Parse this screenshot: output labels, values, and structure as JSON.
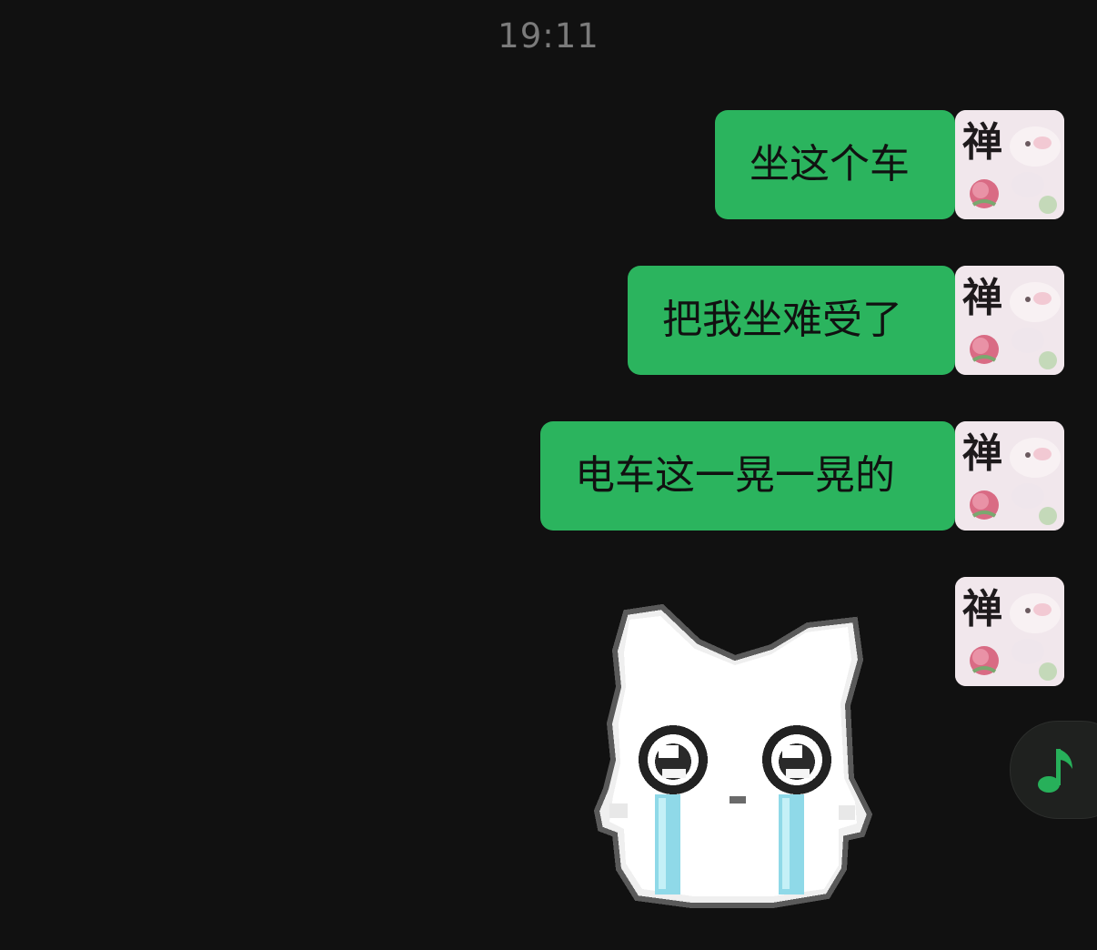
{
  "chat": {
    "timestamp": "19:11",
    "messages": [
      {
        "sender": "self",
        "type": "text",
        "text": "坐这个车"
      },
      {
        "sender": "self",
        "type": "text",
        "text": "把我坐难受了"
      },
      {
        "sender": "self",
        "type": "text",
        "text": "电车这一晃一晃的"
      },
      {
        "sender": "self",
        "type": "sticker",
        "sticker": "crying-white-cat-sticker"
      }
    ],
    "avatar_text": "禅"
  },
  "floating": {
    "music_icon": "music-note-icon",
    "music_color": "#27b05a"
  },
  "colors": {
    "background": "#111111",
    "bubble": "#2bb45e",
    "timestamp": "#7b7b7b"
  }
}
